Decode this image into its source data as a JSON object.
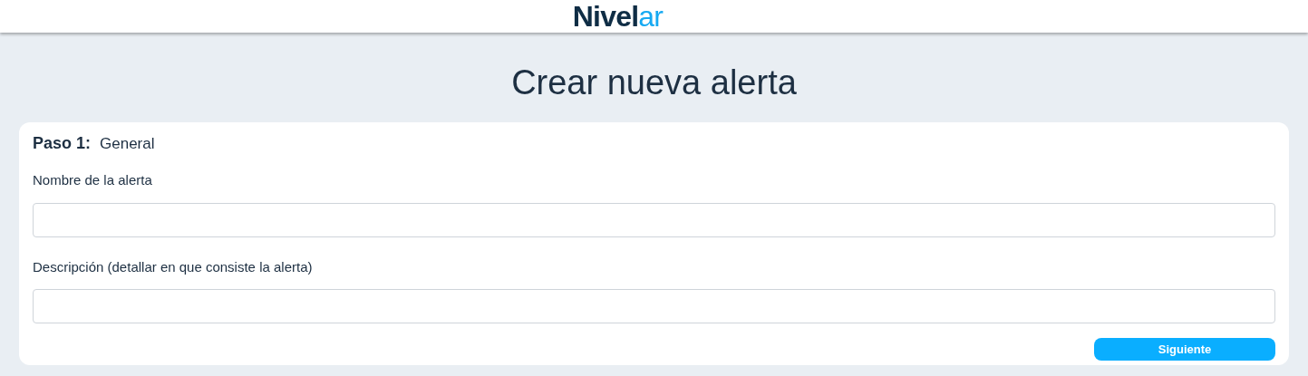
{
  "header": {
    "logo": [
      {
        "text": "Nivel",
        "kind": "dark"
      },
      {
        "text": "ar",
        "kind": "accent"
      }
    ]
  },
  "title": "Crear nueva alerta",
  "step": {
    "label": "Paso 1:",
    "name": "General"
  },
  "fields": [
    {
      "label": "Nombre de la alerta"
    },
    {
      "label": "Descripción (detallar en que consiste la alerta)"
    }
  ],
  "buttons": [
    "Siguiente"
  ]
}
